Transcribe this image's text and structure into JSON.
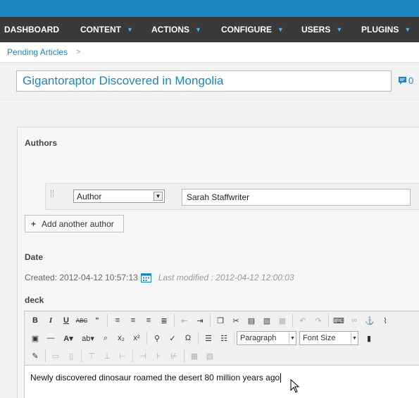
{
  "nav": {
    "items": [
      {
        "label": "DASHBOARD",
        "has_caret": false
      },
      {
        "label": "CONTENT",
        "has_caret": true
      },
      {
        "label": "ACTIONS",
        "has_caret": true
      },
      {
        "label": "CONFIGURE",
        "has_caret": true
      },
      {
        "label": "USERS",
        "has_caret": true
      },
      {
        "label": "PLUGINS",
        "has_caret": true
      }
    ],
    "caret_glyph": "▼"
  },
  "breadcrumb": {
    "link": "Pending Articles",
    "separator": ">"
  },
  "article": {
    "title": "Gigantoraptor Discovered in Mongolia",
    "comment_count": "0"
  },
  "authors": {
    "heading": "Authors",
    "rows": [
      {
        "role": "Author",
        "name": "Sarah Staffwriter"
      }
    ],
    "add_label": "Add another author",
    "add_icon": "+"
  },
  "date": {
    "heading": "Date",
    "created": "Created: 2012-04-12 10:57:13",
    "modified": "Last modified : 2012-04-12 12:00:03"
  },
  "deck": {
    "heading": "deck",
    "format_select": "Paragraph",
    "size_select": "Font Size",
    "content": "Newly discovered dinosaur roamed the desert 80 million years ago"
  },
  "colors": {
    "brand_blue": "#1a86c2",
    "nav_bg": "#3a3a3a",
    "caret_blue": "#4fb2e8",
    "panel_bg": "#f6f6f6"
  }
}
